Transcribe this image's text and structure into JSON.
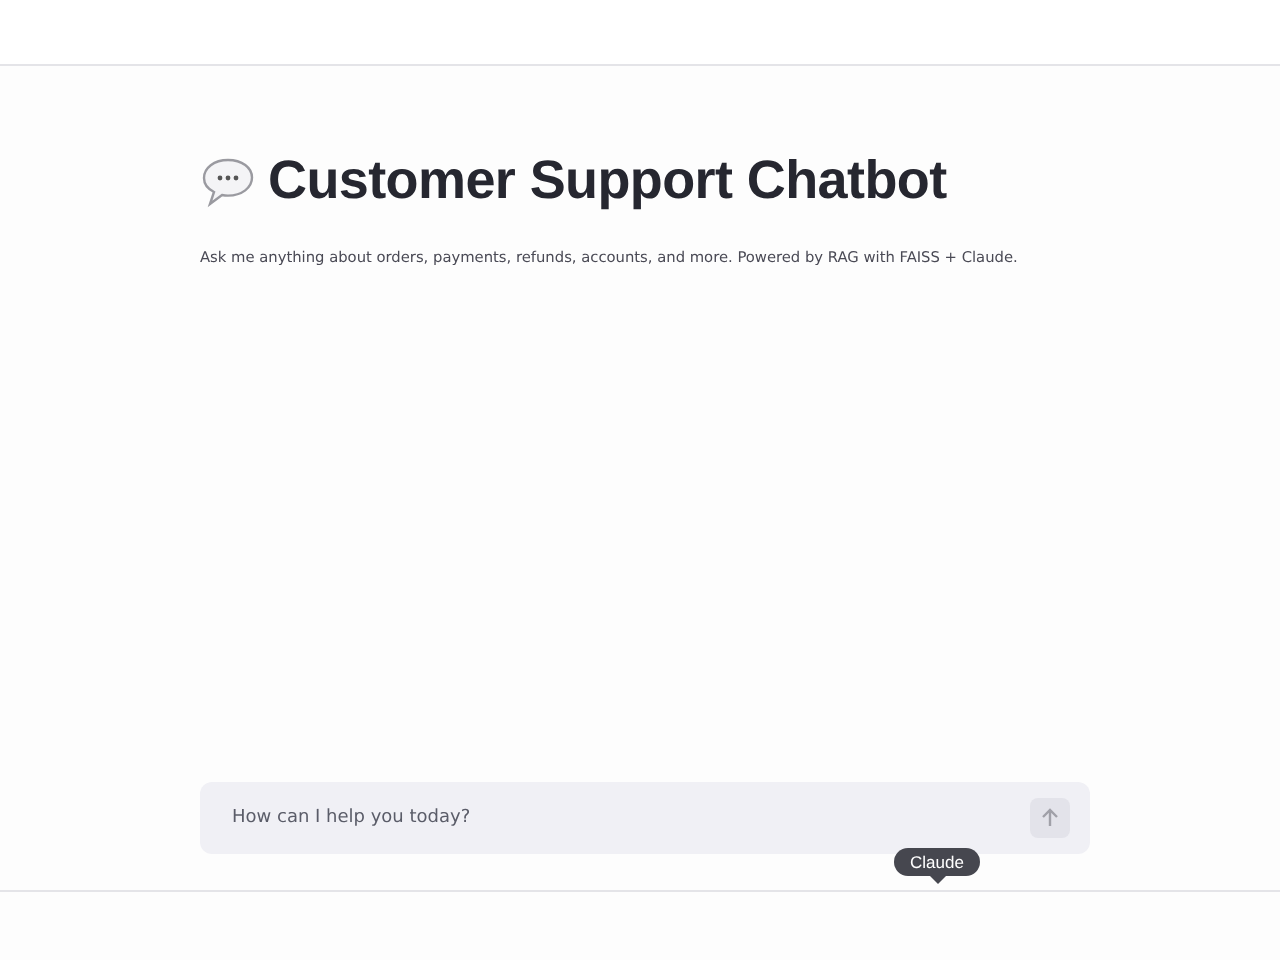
{
  "header": {
    "title": "Customer Support Chatbot",
    "caption": "Ask me anything about orders, payments, refunds, accounts, and more. Powered by RAG with FAISS + Claude."
  },
  "chat_input": {
    "placeholder": "How can I help you today?"
  },
  "tooltip": {
    "text": "Claude"
  }
}
